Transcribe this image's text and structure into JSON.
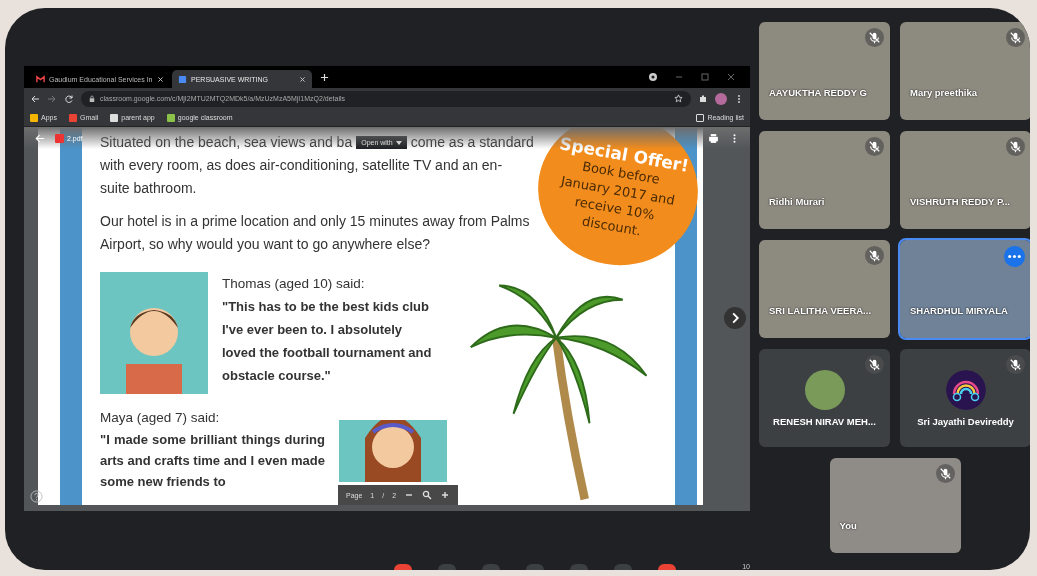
{
  "browser": {
    "tabs": [
      {
        "label": "Gaudium Educational Services In",
        "selected": false
      },
      {
        "label": "PERSUASIVE WRITING",
        "selected": true
      }
    ],
    "url": "classroom.google.com/c/MjI2MTU2MTQ2MDk5/a/MzUzMzA5MjI1MzQ2/details",
    "bookmarks": [
      "Apps",
      "Gmail",
      "parent app",
      "google classroom"
    ],
    "reading_list": "Reading list"
  },
  "pdf_viewer": {
    "file_name": "2.pdf",
    "open_with": "Open with",
    "line_1_start": "Situated on the beach, sea views and ba",
    "line_1_end": "come as a standard",
    "paragraph_1_rest": "with every room, as does air-conditioning, satellite TV and an en-suite bathroom.",
    "paragraph_2": "Our hotel is in a prime location and only 15 minutes away from Palms Airport, so why would you want to go anywhere else?",
    "offer_title": "Special Offer!",
    "offer_text": "Book before January 2017 and receive 10% discount.",
    "review_1_author": "Thomas (aged 10) said:",
    "review_1_quote": "\"This has to be the best kids club I've ever been to. I absolutely loved the football tournament and obstacle course.\"",
    "review_2_author": "Maya (aged 7) said:",
    "review_2_quote": "\"I made some brilliant things during arts and crafts time and I even made some new friends to",
    "page_label": "Page",
    "page_current": "1",
    "page_separator": "/",
    "page_total": "2"
  },
  "participants": [
    {
      "name": "AAYUKTHA REDDY G",
      "kind": "video",
      "muted": true,
      "selected": false
    },
    {
      "name": "Mary preethika",
      "kind": "video",
      "muted": true,
      "selected": false
    },
    {
      "name": "Ridhi Murari",
      "kind": "video",
      "muted": true,
      "selected": false
    },
    {
      "name": "VISHRUTH REDDY P...",
      "kind": "video",
      "muted": true,
      "selected": false
    },
    {
      "name": "SRI LALITHA VEERA...",
      "kind": "video",
      "muted": true,
      "selected": false
    },
    {
      "name": "SHARDHUL MIRYALA",
      "kind": "screen",
      "muted": false,
      "selected": true
    },
    {
      "name": "RENESH NIRAV MEH...",
      "kind": "photo_avatar",
      "muted": true,
      "selected": false
    },
    {
      "name": "Sri Jayathi Devireddy",
      "kind": "rainbow_avatar",
      "muted": true,
      "selected": false
    }
  ],
  "self_view": {
    "name": "You",
    "muted": true
  },
  "call_controls": {
    "participant_count": "10"
  }
}
